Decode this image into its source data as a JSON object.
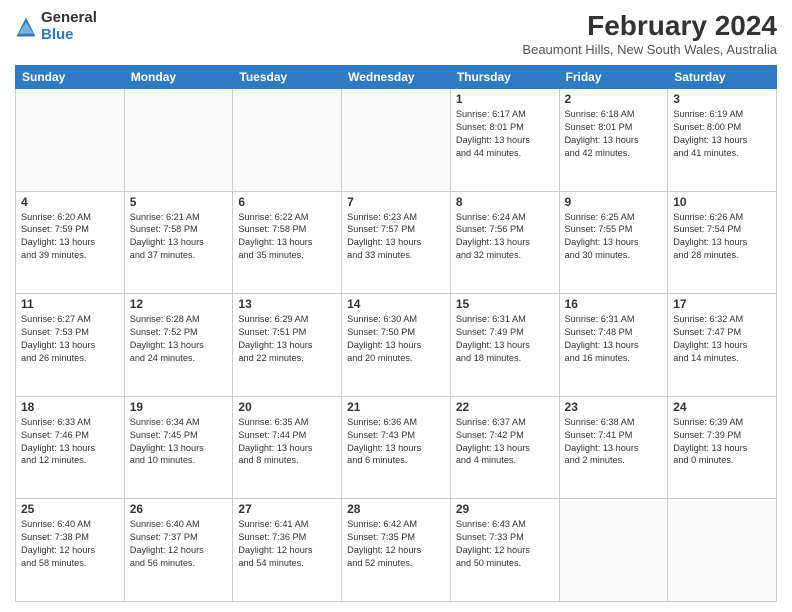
{
  "logo": {
    "general": "General",
    "blue": "Blue"
  },
  "title": "February 2024",
  "subtitle": "Beaumont Hills, New South Wales, Australia",
  "days_of_week": [
    "Sunday",
    "Monday",
    "Tuesday",
    "Wednesday",
    "Thursday",
    "Friday",
    "Saturday"
  ],
  "weeks": [
    [
      {
        "num": "",
        "info": ""
      },
      {
        "num": "",
        "info": ""
      },
      {
        "num": "",
        "info": ""
      },
      {
        "num": "",
        "info": ""
      },
      {
        "num": "1",
        "info": "Sunrise: 6:17 AM\nSunset: 8:01 PM\nDaylight: 13 hours\nand 44 minutes."
      },
      {
        "num": "2",
        "info": "Sunrise: 6:18 AM\nSunset: 8:01 PM\nDaylight: 13 hours\nand 42 minutes."
      },
      {
        "num": "3",
        "info": "Sunrise: 6:19 AM\nSunset: 8:00 PM\nDaylight: 13 hours\nand 41 minutes."
      }
    ],
    [
      {
        "num": "4",
        "info": "Sunrise: 6:20 AM\nSunset: 7:59 PM\nDaylight: 13 hours\nand 39 minutes."
      },
      {
        "num": "5",
        "info": "Sunrise: 6:21 AM\nSunset: 7:58 PM\nDaylight: 13 hours\nand 37 minutes."
      },
      {
        "num": "6",
        "info": "Sunrise: 6:22 AM\nSunset: 7:58 PM\nDaylight: 13 hours\nand 35 minutes."
      },
      {
        "num": "7",
        "info": "Sunrise: 6:23 AM\nSunset: 7:57 PM\nDaylight: 13 hours\nand 33 minutes."
      },
      {
        "num": "8",
        "info": "Sunrise: 6:24 AM\nSunset: 7:56 PM\nDaylight: 13 hours\nand 32 minutes."
      },
      {
        "num": "9",
        "info": "Sunrise: 6:25 AM\nSunset: 7:55 PM\nDaylight: 13 hours\nand 30 minutes."
      },
      {
        "num": "10",
        "info": "Sunrise: 6:26 AM\nSunset: 7:54 PM\nDaylight: 13 hours\nand 28 minutes."
      }
    ],
    [
      {
        "num": "11",
        "info": "Sunrise: 6:27 AM\nSunset: 7:53 PM\nDaylight: 13 hours\nand 26 minutes."
      },
      {
        "num": "12",
        "info": "Sunrise: 6:28 AM\nSunset: 7:52 PM\nDaylight: 13 hours\nand 24 minutes."
      },
      {
        "num": "13",
        "info": "Sunrise: 6:29 AM\nSunset: 7:51 PM\nDaylight: 13 hours\nand 22 minutes."
      },
      {
        "num": "14",
        "info": "Sunrise: 6:30 AM\nSunset: 7:50 PM\nDaylight: 13 hours\nand 20 minutes."
      },
      {
        "num": "15",
        "info": "Sunrise: 6:31 AM\nSunset: 7:49 PM\nDaylight: 13 hours\nand 18 minutes."
      },
      {
        "num": "16",
        "info": "Sunrise: 6:31 AM\nSunset: 7:48 PM\nDaylight: 13 hours\nand 16 minutes."
      },
      {
        "num": "17",
        "info": "Sunrise: 6:32 AM\nSunset: 7:47 PM\nDaylight: 13 hours\nand 14 minutes."
      }
    ],
    [
      {
        "num": "18",
        "info": "Sunrise: 6:33 AM\nSunset: 7:46 PM\nDaylight: 13 hours\nand 12 minutes."
      },
      {
        "num": "19",
        "info": "Sunrise: 6:34 AM\nSunset: 7:45 PM\nDaylight: 13 hours\nand 10 minutes."
      },
      {
        "num": "20",
        "info": "Sunrise: 6:35 AM\nSunset: 7:44 PM\nDaylight: 13 hours\nand 8 minutes."
      },
      {
        "num": "21",
        "info": "Sunrise: 6:36 AM\nSunset: 7:43 PM\nDaylight: 13 hours\nand 6 minutes."
      },
      {
        "num": "22",
        "info": "Sunrise: 6:37 AM\nSunset: 7:42 PM\nDaylight: 13 hours\nand 4 minutes."
      },
      {
        "num": "23",
        "info": "Sunrise: 6:38 AM\nSunset: 7:41 PM\nDaylight: 13 hours\nand 2 minutes."
      },
      {
        "num": "24",
        "info": "Sunrise: 6:39 AM\nSunset: 7:39 PM\nDaylight: 13 hours\nand 0 minutes."
      }
    ],
    [
      {
        "num": "25",
        "info": "Sunrise: 6:40 AM\nSunset: 7:38 PM\nDaylight: 12 hours\nand 58 minutes."
      },
      {
        "num": "26",
        "info": "Sunrise: 6:40 AM\nSunset: 7:37 PM\nDaylight: 12 hours\nand 56 minutes."
      },
      {
        "num": "27",
        "info": "Sunrise: 6:41 AM\nSunset: 7:36 PM\nDaylight: 12 hours\nand 54 minutes."
      },
      {
        "num": "28",
        "info": "Sunrise: 6:42 AM\nSunset: 7:35 PM\nDaylight: 12 hours\nand 52 minutes."
      },
      {
        "num": "29",
        "info": "Sunrise: 6:43 AM\nSunset: 7:33 PM\nDaylight: 12 hours\nand 50 minutes."
      },
      {
        "num": "",
        "info": ""
      },
      {
        "num": "",
        "info": ""
      }
    ]
  ]
}
